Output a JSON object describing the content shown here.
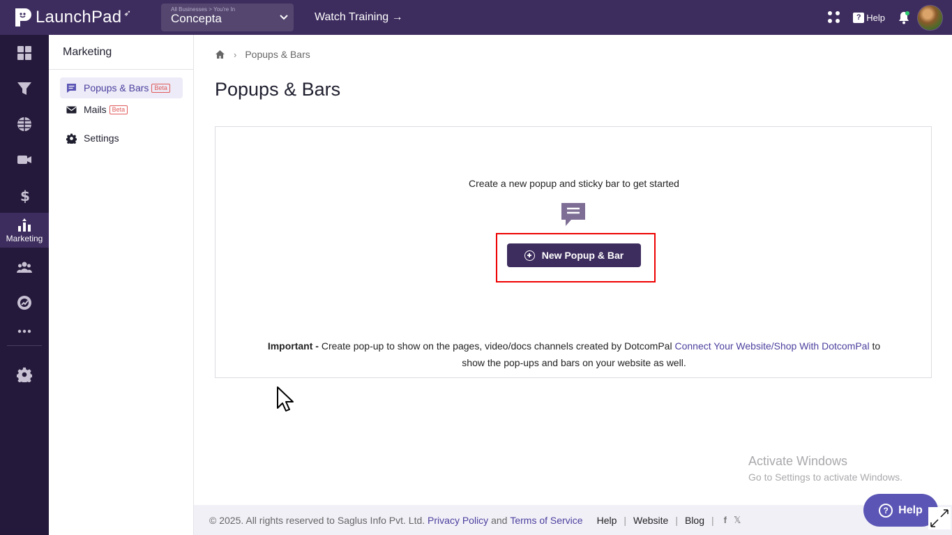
{
  "topbar": {
    "logo_text": "LaunchPad",
    "biz_small": "All Businesses > You're In",
    "biz_name": "Concepta",
    "watch_training": "Watch Training →",
    "help_label": "Help",
    "help_glyph": "?"
  },
  "iconbar": {
    "items": [
      "dashboard-icon",
      "funnel-icon",
      "globe-icon",
      "video-icon",
      "dollar-icon",
      "marketing-icon",
      "users-icon",
      "analytics-icon",
      "more-icon",
      "settings-icon"
    ],
    "active_label": "Marketing"
  },
  "subnav": {
    "title": "Marketing",
    "items": [
      {
        "label": "Popups & Bars",
        "badge": "Beta"
      },
      {
        "label": "Mails",
        "badge": "Beta"
      },
      {
        "label": "Settings"
      }
    ]
  },
  "breadcrumb": {
    "current": "Popups & Bars",
    "separator": "›"
  },
  "page_title": "Popups & Bars",
  "card": {
    "message": "Create a new popup and sticky bar to get started",
    "button_label": "New Popup & Bar",
    "important_bold": "Important -",
    "important_text": " Create pop-up to show on the pages, video/docs channels created by DotcomPal ",
    "important_link": "Connect Your Website/Shop With DotcomPal",
    "important_tail": " to show the pop-ups and bars on your website as well."
  },
  "watermark": {
    "line1": "Activate Windows",
    "line2": "Go to Settings to activate Windows."
  },
  "footer": {
    "copyright": "©  2025. All rights reserved to Saglus Info Pvt. Ltd.",
    "privacy": "Privacy Policy",
    "and": "and",
    "terms": "Terms of Service",
    "links": [
      "Help",
      "Website",
      "Blog"
    ],
    "sep": "|",
    "social_fb": "f",
    "social_x": "𝕏"
  },
  "help_fab": {
    "label": "Help",
    "glyph": "?"
  },
  "colors": {
    "brand": "#3d2c5e",
    "sidebar": "#24193a",
    "accent": "#4b3f9e",
    "highlight": "#e00000"
  }
}
